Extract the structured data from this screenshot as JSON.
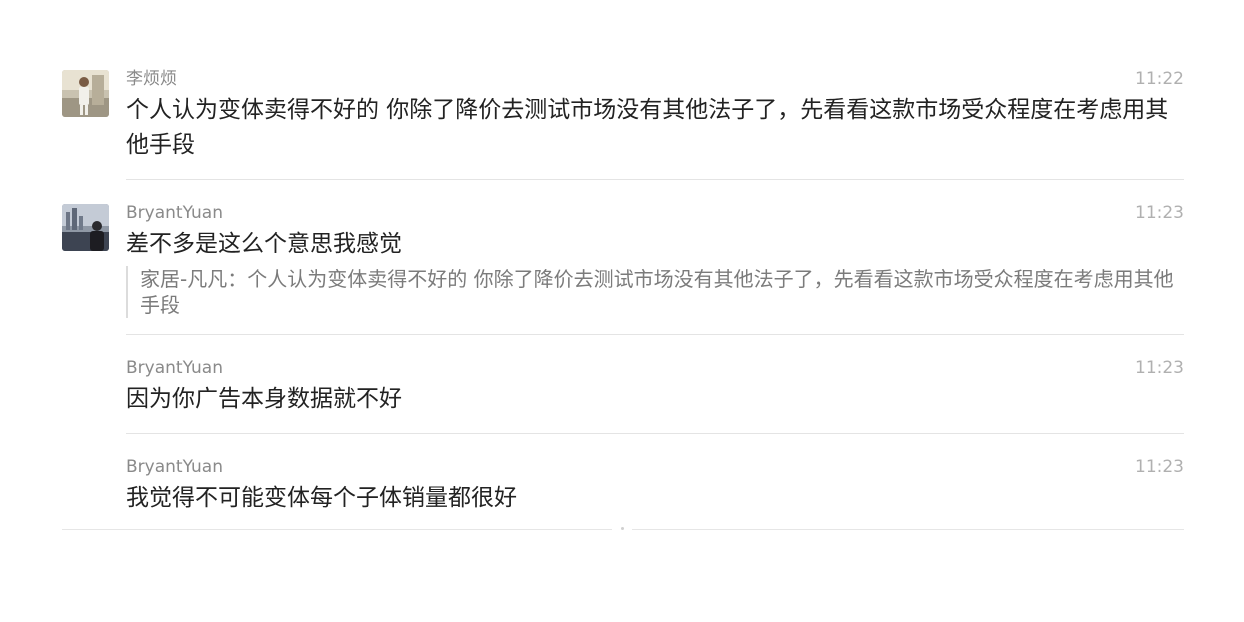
{
  "messages": [
    {
      "sender": "李烦烦",
      "time": "11:22",
      "text": "个人认为变体卖得不好的 你除了降价去测试市场没有其他法子了，先看看这款市场受众程度在考虑用其他手段"
    },
    {
      "sender": "BryantYuan",
      "time": "11:23",
      "text": "差不多是这么个意思我感觉",
      "quote": "家居-凡凡：个人认为变体卖得不好的 你除了降价去测试市场没有其他法子了，先看看这款市场受众程度在考虑用其他手段"
    },
    {
      "sender": "BryantYuan",
      "time": "11:23",
      "text": "因为你广告本身数据就不好"
    },
    {
      "sender": "BryantYuan",
      "time": "11:23",
      "text": "我觉得不可能变体每个子体销量都很好"
    }
  ]
}
